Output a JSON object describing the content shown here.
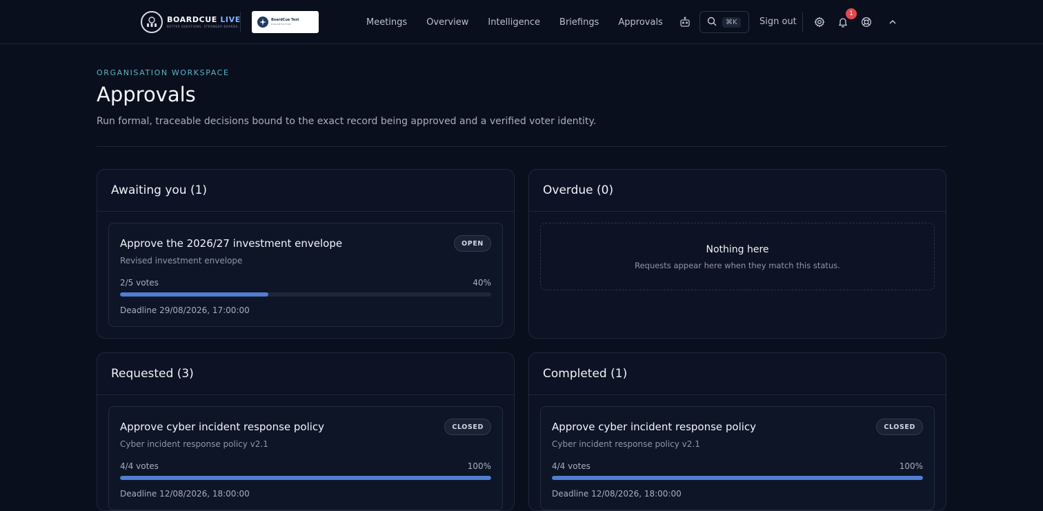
{
  "brand": {
    "name_main": "BOARDCUE",
    "name_accent": "LIVE",
    "tagline": "BETTER QUESTIONS. STRONGER BOARDS.",
    "org_name": "BoardCue Test",
    "org_sub": "ORGANISATION"
  },
  "nav": {
    "items": [
      "Meetings",
      "Overview",
      "Intelligence",
      "Briefings",
      "Approvals"
    ],
    "bot_icon": "robot-icon"
  },
  "header_actions": {
    "search_shortcut": "⌘K",
    "sign_out": "Sign out",
    "notification_count": "1",
    "icons": [
      "search-icon",
      "gear-icon",
      "bell-icon",
      "lifebuoy-icon",
      "chevron-up-icon"
    ]
  },
  "page": {
    "eyebrow": "ORGANISATION WORKSPACE",
    "title": "Approvals",
    "description": "Run formal, traceable decisions bound to the exact record being approved and a verified voter identity."
  },
  "panels": {
    "awaiting": {
      "title": "Awaiting you (1)",
      "card": {
        "title": "Approve the 2026/27 investment envelope",
        "subtitle": "Revised investment envelope",
        "status": "OPEN",
        "votes": "2/5 votes",
        "percent_label": "40%",
        "progress": 0.4,
        "deadline": "Deadline 29/08/2026, 17:00:00"
      }
    },
    "overdue": {
      "title": "Overdue (0)",
      "empty_title": "Nothing here",
      "empty_desc": "Requests appear here when they match this status."
    },
    "requested": {
      "title": "Requested (3)",
      "card": {
        "title": "Approve cyber incident response policy",
        "subtitle": "Cyber incident response policy v2.1",
        "status": "CLOSED",
        "votes": "4/4 votes",
        "percent_label": "100%",
        "progress": 1.0,
        "deadline": "Deadline 12/08/2026, 18:00:00"
      }
    },
    "completed": {
      "title": "Completed (1)",
      "card": {
        "title": "Approve cyber incident response policy",
        "subtitle": "Cyber incident response policy v2.1",
        "status": "CLOSED",
        "votes": "4/4 votes",
        "percent_label": "100%",
        "progress": 1.0,
        "deadline": "Deadline 12/08/2026, 18:00:00"
      }
    }
  },
  "colors": {
    "background": "#0a0f1e",
    "progress_fill": "#4f7fd0",
    "eyebrow": "#5fb3c4",
    "notification_badge": "#e5484d"
  }
}
